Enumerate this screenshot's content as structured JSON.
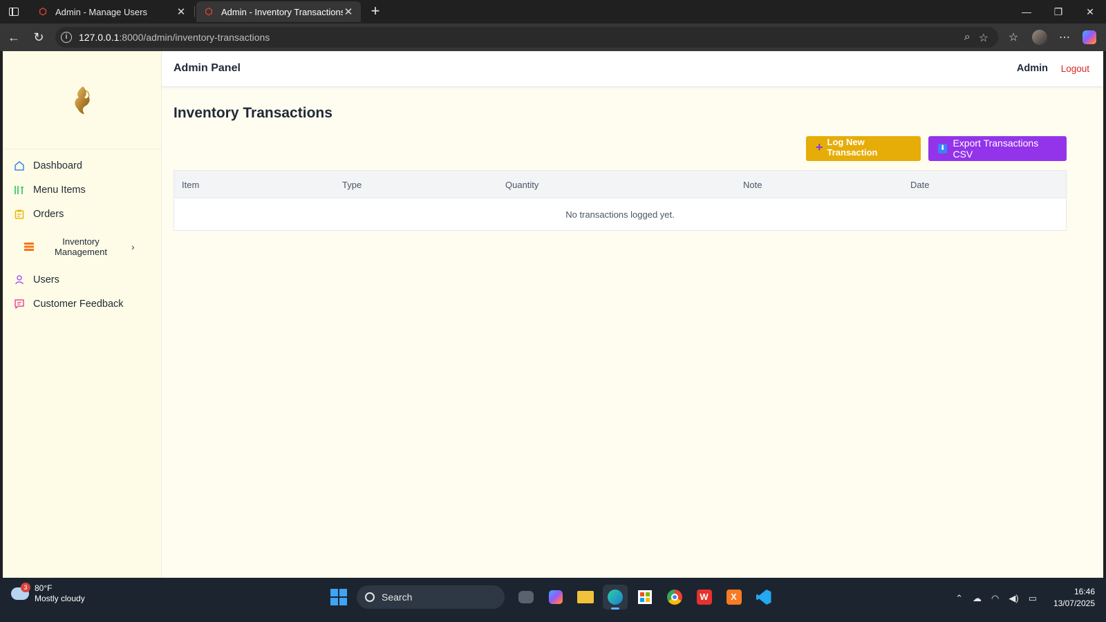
{
  "browser": {
    "tabs": [
      {
        "title": "Admin - Manage Users",
        "active": false
      },
      {
        "title": "Admin - Inventory Transactions",
        "active": true
      }
    ],
    "url_host": "127.0.0.1",
    "url_rest": ":8000/admin/inventory-transactions"
  },
  "sidebar": {
    "items": [
      {
        "label": "Dashboard",
        "icon": "home-icon",
        "color": "#3b82f6"
      },
      {
        "label": "Menu Items",
        "icon": "bars-icon",
        "color": "#22c55e"
      },
      {
        "label": "Orders",
        "icon": "clipboard-icon",
        "color": "#eab308"
      },
      {
        "label": "Inventory Management",
        "icon": "layers-icon",
        "color": "#f97316"
      },
      {
        "label": "Users",
        "icon": "user-icon",
        "color": "#a855f7"
      },
      {
        "label": "Customer Feedback",
        "icon": "chat-icon",
        "color": "#ec4899"
      }
    ]
  },
  "topbar": {
    "brand": "Admin Panel",
    "user": "Admin",
    "logout": "Logout"
  },
  "main": {
    "title": "Inventory Transactions",
    "log_button": "Log New Transaction",
    "export_button": "Export Transactions CSV",
    "columns": [
      "Item",
      "Type",
      "Quantity",
      "Note",
      "Date"
    ],
    "empty_message": "No transactions logged yet."
  },
  "taskbar": {
    "weather_temp": "80°F",
    "weather_desc": "Mostly cloudy",
    "weather_badge": "3",
    "search_label": "Search",
    "time": "16:46",
    "date": "13/07/2025"
  },
  "colors": {
    "accent_yellow": "#e6ad08",
    "accent_purple": "#9333ea",
    "logout_red": "#dc2626",
    "page_bg": "#fffcf0"
  }
}
